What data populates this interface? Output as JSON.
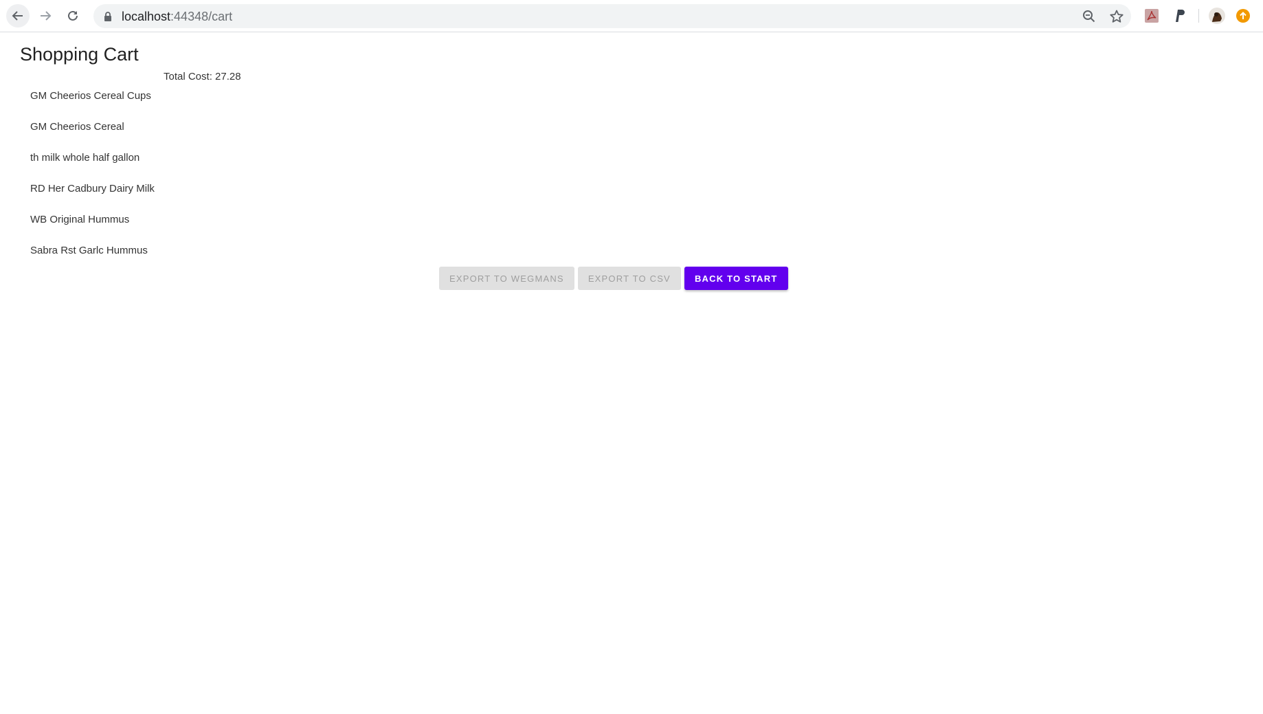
{
  "browser": {
    "url_host": "localhost",
    "url_path": ":44348/cart"
  },
  "page": {
    "title": "Shopping Cart",
    "total_cost": "Total Cost: 27.28",
    "items": [
      "GM Cheerios Cereal Cups",
      "GM Cheerios Cereal",
      "th milk whole half gallon",
      "RD Her Cadbury Dairy Milk",
      "WB Original Hummus",
      "Sabra Rst Garlc Hummus"
    ]
  },
  "actions": {
    "export_wegmans": "Export to Wegmans",
    "export_csv": "Export to CSV",
    "back_to_start": "Back to Start"
  },
  "colors": {
    "primary": "#6200ee",
    "disabled_bg": "#e0e0e0",
    "disabled_text": "#9e9e9e"
  }
}
